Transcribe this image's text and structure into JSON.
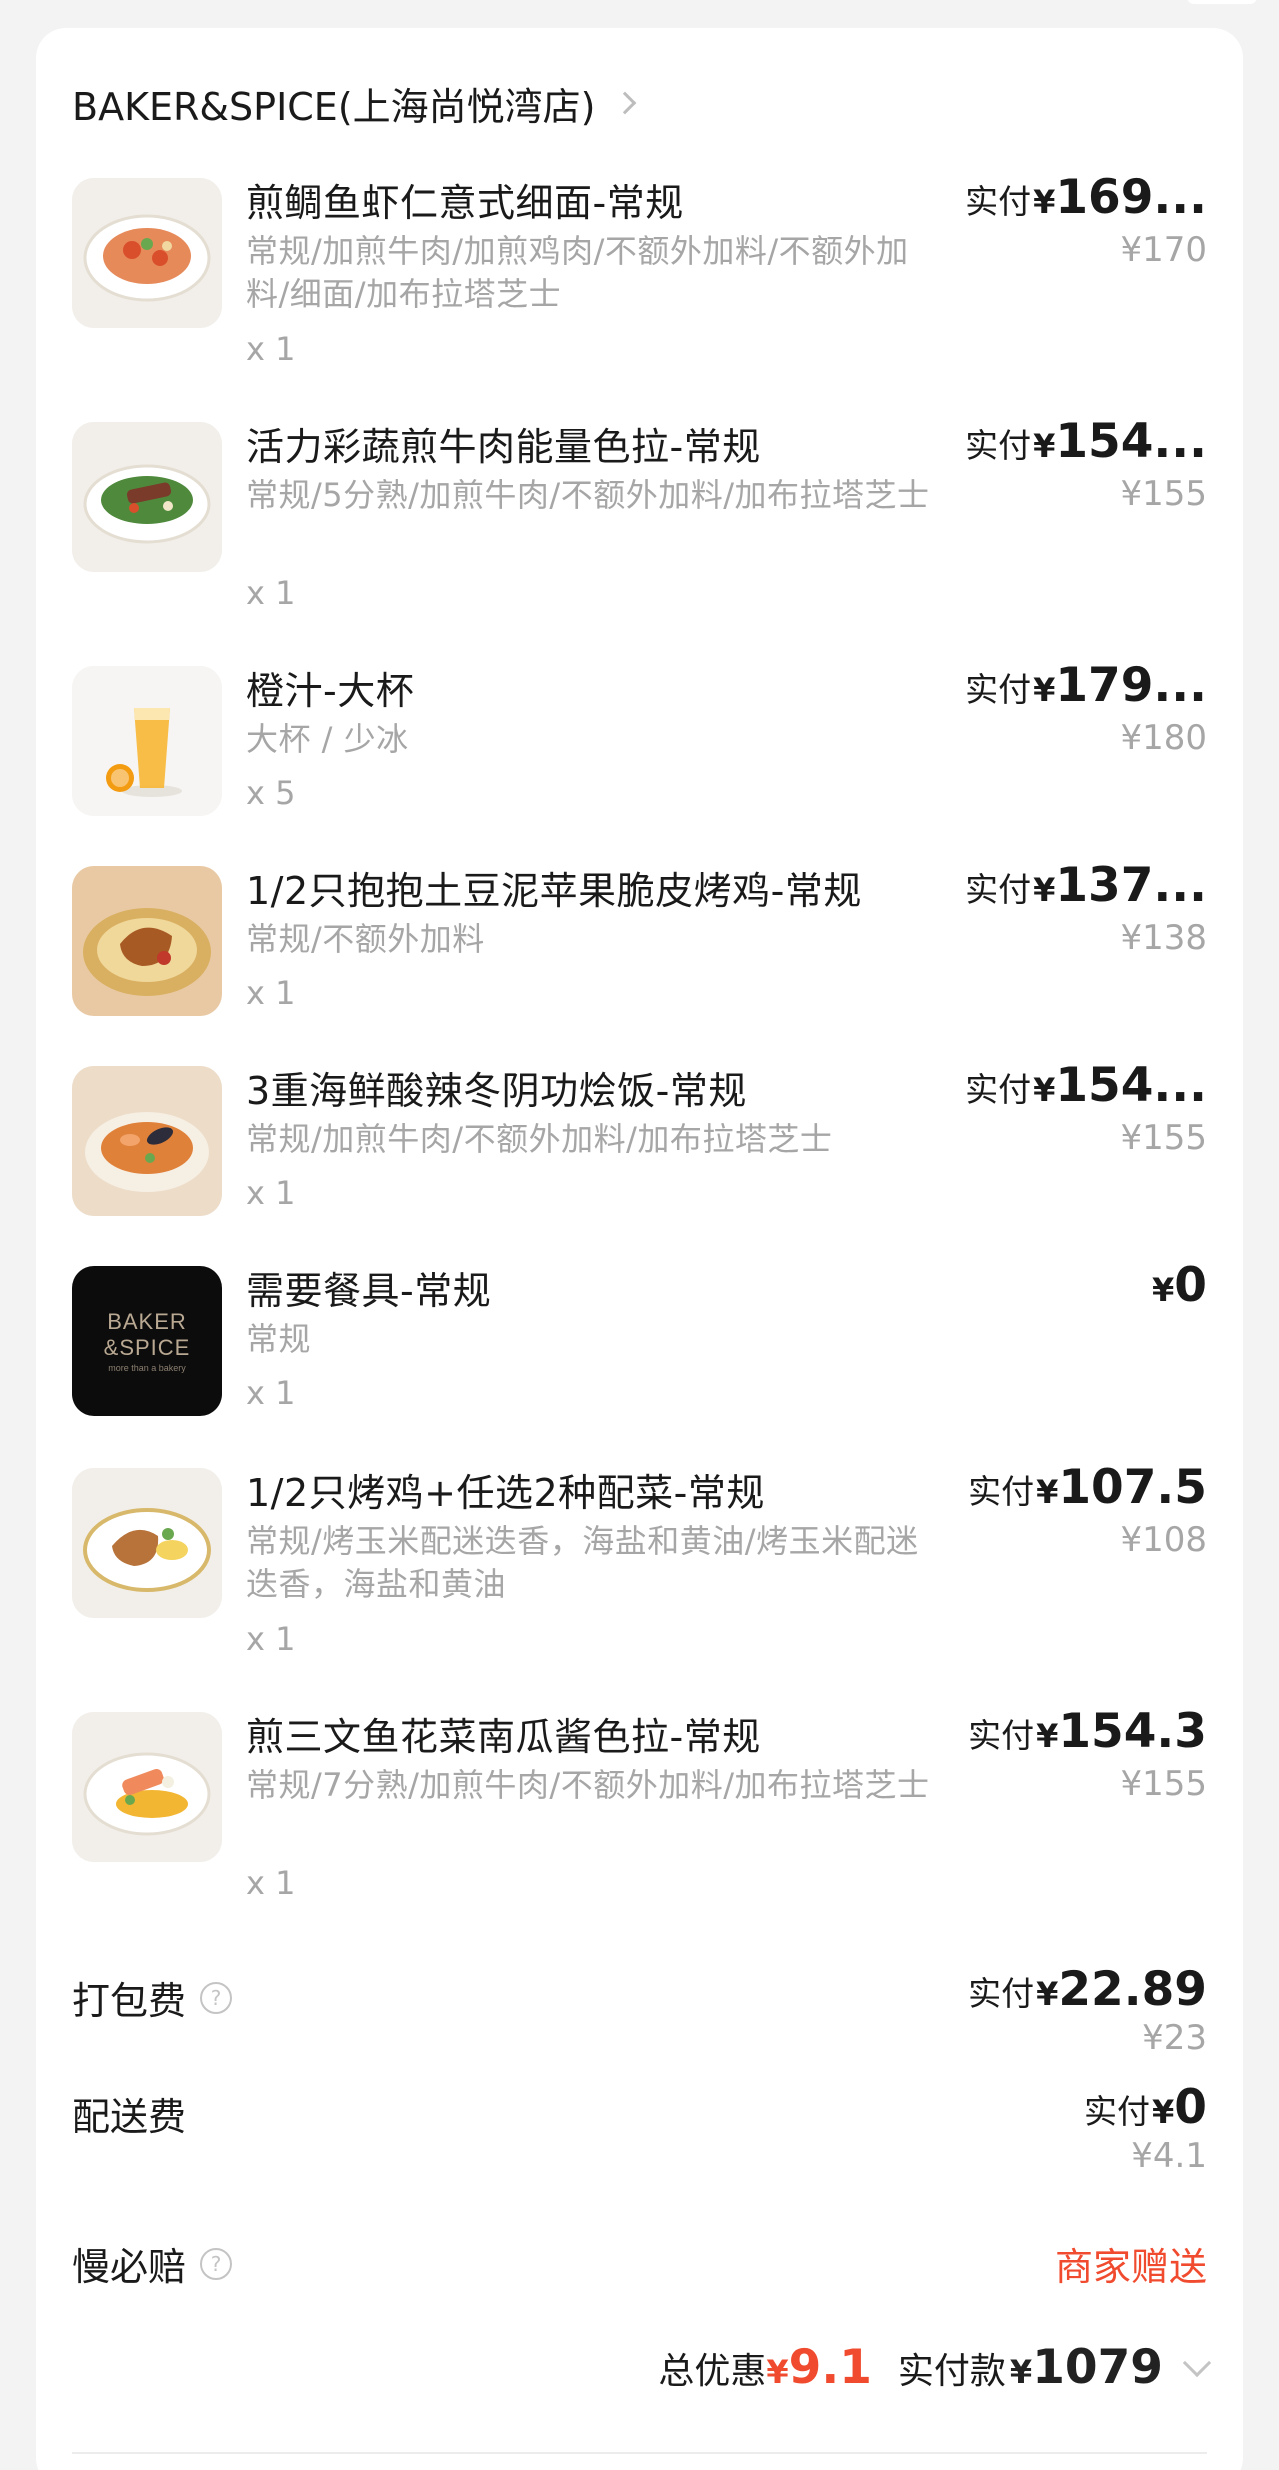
{
  "store": {
    "name": "BAKER&SPICE(上海尚悦湾店)"
  },
  "paid_label": "实付",
  "currency": "¥",
  "items": [
    {
      "name": "煎鲷鱼虾仁意式细面-常规",
      "spec": "常规/加煎牛肉/加煎鸡肉/不额外加料/不额外加料/细面/加布拉塔芝士",
      "qty": "x 1",
      "paid": "169...",
      "orig": "¥170",
      "icon": "pasta-dish-icon"
    },
    {
      "name": "活力彩蔬煎牛肉能量色拉-常规",
      "spec": "常规/5分熟/加煎牛肉/不额外加料/加布拉塔芝士",
      "qty": "x 1",
      "paid": "154...",
      "orig": "¥155",
      "icon": "beef-salad-icon"
    },
    {
      "name": "橙汁-大杯",
      "spec": "大杯 / 少冰",
      "qty": "x 5",
      "paid": "179...",
      "orig": "¥180",
      "icon": "orange-juice-icon"
    },
    {
      "name": "1/2只抱抱土豆泥苹果脆皮烤鸡-常规",
      "spec": "常规/不额外加料",
      "qty": "x 1",
      "paid": "137...",
      "orig": "¥138",
      "icon": "roast-chicken-icon"
    },
    {
      "name": "3重海鲜酸辣冬阴功烩饭-常规",
      "spec": "常规/加煎牛肉/不额外加料/加布拉塔芝士",
      "qty": "x 1",
      "paid": "154...",
      "orig": "¥155",
      "icon": "seafood-rice-icon"
    },
    {
      "name": "需要餐具-常规",
      "spec": "常规",
      "qty": "x 1",
      "price_plain": "0",
      "logo_line1": "BAKER",
      "logo_line2": "&SPICE",
      "logo_tagline": "more than a bakery",
      "icon": "baker-spice-logo"
    },
    {
      "name": "1/2只烤鸡+任选2种配菜-常规",
      "spec": "常规/烤玉米配迷迭香，海盐和黄油/烤玉米配迷迭香，海盐和黄油",
      "qty": "x 1",
      "paid": "107.5",
      "orig": "¥108",
      "icon": "chicken-sides-icon"
    },
    {
      "name": "煎三文鱼花菜南瓜酱色拉-常规",
      "spec": "常规/7分熟/加煎牛肉/不额外加料/加布拉塔芝士",
      "qty": "x 1",
      "paid": "154.3",
      "orig": "¥155",
      "icon": "salmon-salad-icon"
    }
  ],
  "fees": {
    "packing": {
      "label": "打包费",
      "paid": "22.89",
      "orig": "¥23"
    },
    "delivery": {
      "label": "配送费",
      "paid": "0",
      "orig": "¥4.1"
    },
    "late": {
      "label": "慢必赔",
      "value": "商家赠送"
    }
  },
  "summary": {
    "discount_label": "总优惠",
    "discount": "9.1",
    "paid_label": "实付款",
    "paid": "1079"
  },
  "colors": {
    "accent": "#f04b2f",
    "muted": "#a6a6a6",
    "text": "#1a1a1a"
  }
}
